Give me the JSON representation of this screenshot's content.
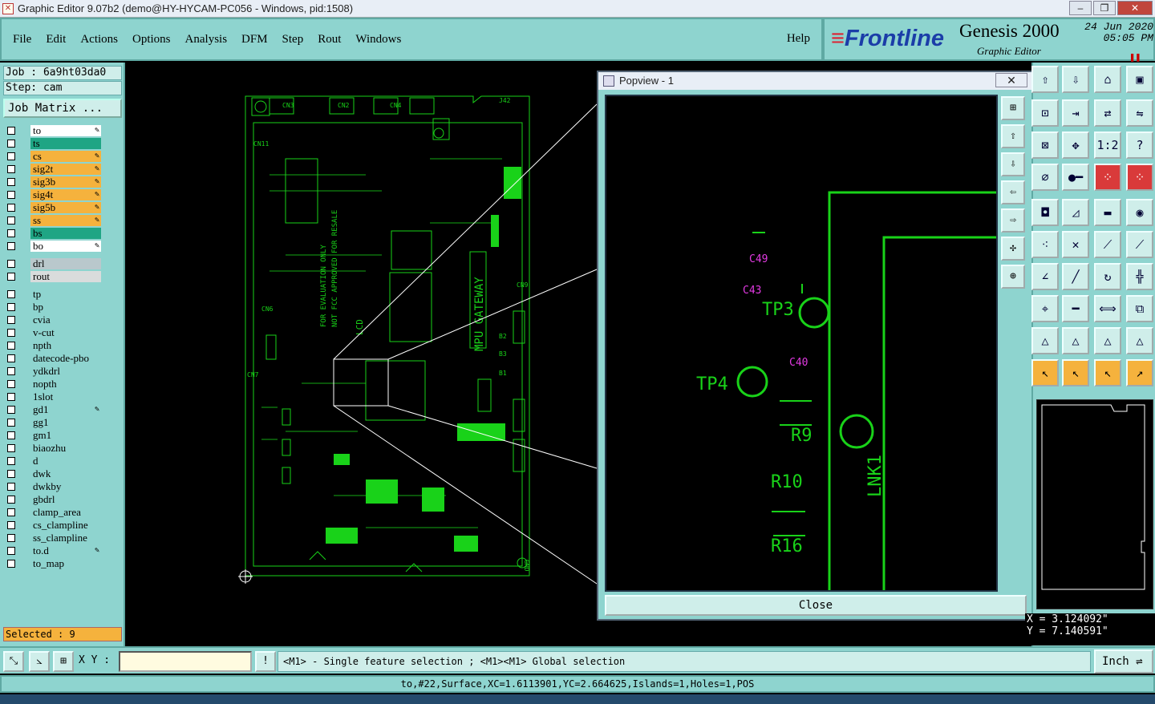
{
  "window": {
    "title": "Graphic Editor 9.07b2 (demo@HY-HYCAM-PC056 - Windows, pid:1508)"
  },
  "menu": [
    "File",
    "Edit",
    "Actions",
    "Options",
    "Analysis",
    "DFM",
    "Step",
    "Rout",
    "Windows"
  ],
  "help_label": "Help",
  "brand": {
    "logo": "Frontline",
    "product": "Genesis 2000",
    "subtitle": "Graphic Editor",
    "date": "24 Jun 2020",
    "time": "05:05 PM"
  },
  "job": {
    "job_line": "Job : 6a9ht03da0",
    "step_line": "Step: cam",
    "matrix_button": "Job Matrix ..."
  },
  "layers": [
    {
      "name": "to",
      "color": "#ffffff",
      "editable": true
    },
    {
      "name": "ts",
      "color": "#1fa584",
      "editable": false
    },
    {
      "name": "cs",
      "color": "#f5b23d",
      "editable": true
    },
    {
      "name": "sig2t",
      "color": "#f5b23d",
      "editable": true
    },
    {
      "name": "sig3b",
      "color": "#f5b23d",
      "editable": true
    },
    {
      "name": "sig4t",
      "color": "#f5b23d",
      "editable": true
    },
    {
      "name": "sig5b",
      "color": "#f5b23d",
      "editable": true
    },
    {
      "name": "ss",
      "color": "#f5b23d",
      "editable": true
    },
    {
      "name": "bs",
      "color": "#1fa584",
      "editable": false
    },
    {
      "name": "bo",
      "color": "#ffffff",
      "editable": true
    },
    {
      "name": "drl",
      "color": "#b9c8cc",
      "editable": false
    },
    {
      "name": "rout",
      "color": "#d9dcdc",
      "editable": false
    },
    {
      "name": "tp",
      "color": "#8ed4cf",
      "editable": false
    },
    {
      "name": "bp",
      "color": "#8ed4cf",
      "editable": false
    },
    {
      "name": "cvia",
      "color": "#8ed4cf",
      "editable": false
    },
    {
      "name": "v-cut",
      "color": "#8ed4cf",
      "editable": false
    },
    {
      "name": "npth",
      "color": "#8ed4cf",
      "editable": false
    },
    {
      "name": "datecode-pbo",
      "color": "#8ed4cf",
      "editable": false
    },
    {
      "name": "ydkdrl",
      "color": "#8ed4cf",
      "editable": false
    },
    {
      "name": "nopth",
      "color": "#8ed4cf",
      "editable": false
    },
    {
      "name": "1slot",
      "color": "#8ed4cf",
      "editable": false
    },
    {
      "name": "gd1",
      "color": "#8ed4cf",
      "editable": true
    },
    {
      "name": "gg1",
      "color": "#8ed4cf",
      "editable": false
    },
    {
      "name": "gm1",
      "color": "#8ed4cf",
      "editable": false
    },
    {
      "name": "biaozhu",
      "color": "#8ed4cf",
      "editable": false
    },
    {
      "name": "d",
      "color": "#8ed4cf",
      "editable": false
    },
    {
      "name": "dwk",
      "color": "#8ed4cf",
      "editable": false
    },
    {
      "name": "dwkby",
      "color": "#8ed4cf",
      "editable": false
    },
    {
      "name": "gbdrl",
      "color": "#8ed4cf",
      "editable": false
    },
    {
      "name": "clamp_area",
      "color": "#8ed4cf",
      "editable": false
    },
    {
      "name": "cs_clampline",
      "color": "#8ed4cf",
      "editable": false
    },
    {
      "name": "ss_clampline",
      "color": "#8ed4cf",
      "editable": false
    },
    {
      "name": "to.d",
      "color": "#8ed4cf",
      "editable": true
    },
    {
      "name": "to_map",
      "color": "#8ed4cf",
      "editable": false
    }
  ],
  "selected": "Selected : 9",
  "board_labels": [
    "CN3",
    "CN2",
    "CN4",
    "CN11",
    "CN6",
    "CN7",
    "CN9",
    "MPU GATEWAY",
    "FOR EVALUATION ONLY",
    "NOT FCC APPROVED FOR RESALE",
    "LCD",
    "B2",
    "B3",
    "B1",
    "J42",
    "GND"
  ],
  "popview": {
    "title": "Popview - 1",
    "close_label": "Close",
    "labels": [
      {
        "text": "C49",
        "color": "#e23ae2"
      },
      {
        "text": "C43",
        "color": "#e23ae2"
      },
      {
        "text": "TP3",
        "color": "#19d219"
      },
      {
        "text": "C40",
        "color": "#e23ae2"
      },
      {
        "text": "TP4",
        "color": "#19d219"
      },
      {
        "text": "R9",
        "color": "#19d219"
      },
      {
        "text": "R10",
        "color": "#19d219"
      },
      {
        "text": "R16",
        "color": "#19d219"
      },
      {
        "text": "LNK1",
        "color": "#19d219"
      }
    ]
  },
  "coords": {
    "x": "X = 3.124092\"",
    "y": "Y = 7.140591\""
  },
  "status": {
    "xy_label": "X Y :",
    "xy_value": "",
    "message": "<M1> - Single feature selection ; <M1><M1> Global selection",
    "unit": "Inch"
  },
  "info": "to,#22,Surface,XC=1.6113901,YC=2.664625,Islands=1,Holes=1,POS",
  "colors": {
    "panel": "#8ed4cf",
    "trace": "#19d219",
    "pink": "#e23ae2"
  }
}
